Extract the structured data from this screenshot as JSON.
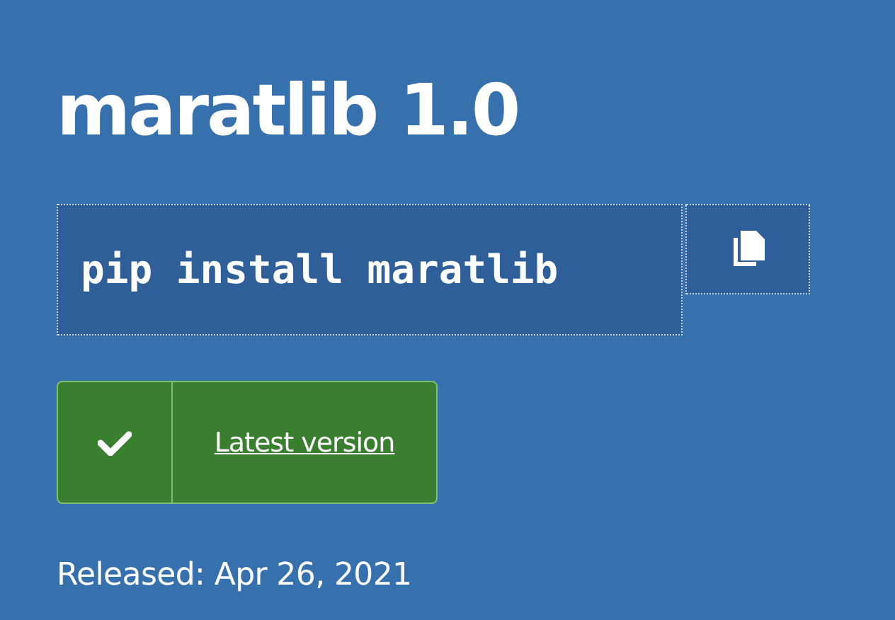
{
  "title": "maratlib 1.0",
  "install_command": "pip install maratlib",
  "version_badge": {
    "label": "Latest version"
  },
  "release_date": "Released: Apr 26, 2021"
}
